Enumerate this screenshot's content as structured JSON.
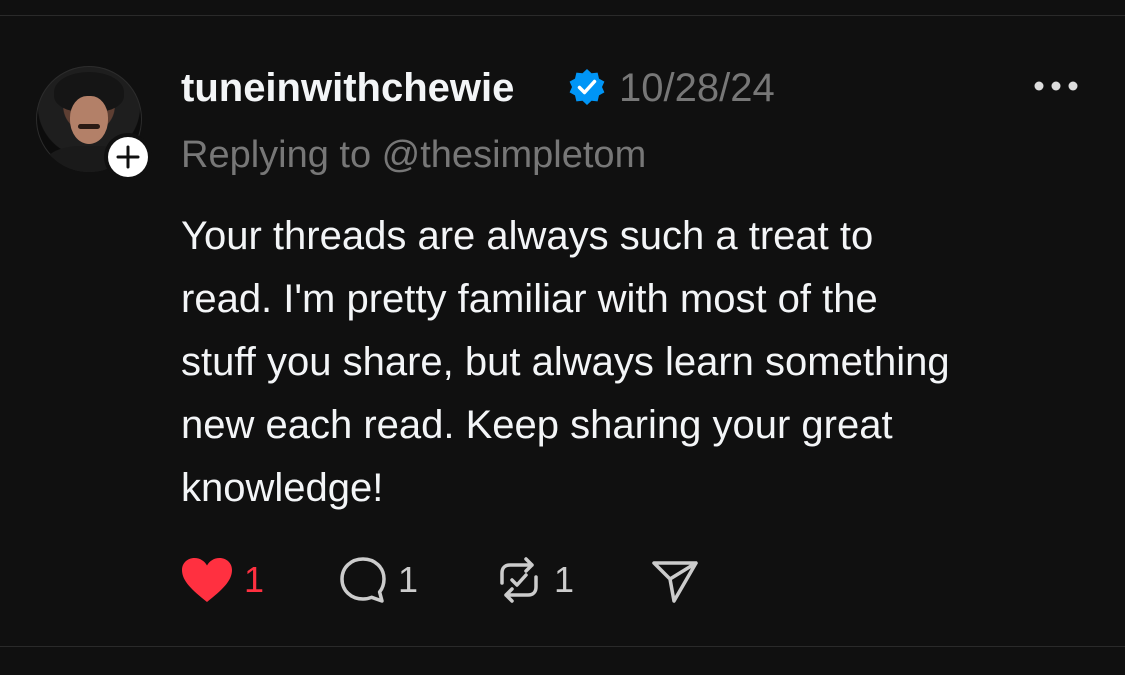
{
  "post": {
    "username": "tuneinwithchewie",
    "verified": true,
    "timestamp": "10/28/24",
    "replying_to": "Replying to @thesimpletom",
    "body": "Your threads are always such a treat to\nread. I'm pretty familiar with most of the\nstuff you share, but always learn something\nnew each read. Keep sharing your great\nknowledge!",
    "avatar_icon": "profile-photo",
    "follow_icon": "plus-icon"
  },
  "actions": {
    "like_count": "1",
    "comment_count": "1",
    "repost_count": "1",
    "like_icon": "heart-icon",
    "comment_icon": "speech-bubble-icon",
    "repost_icon": "repost-icon",
    "share_icon": "send-icon"
  },
  "colors": {
    "background": "#101010",
    "text": "#f3f5f7",
    "muted": "#777777",
    "like": "#ff3040",
    "verified": "#0095f6"
  }
}
